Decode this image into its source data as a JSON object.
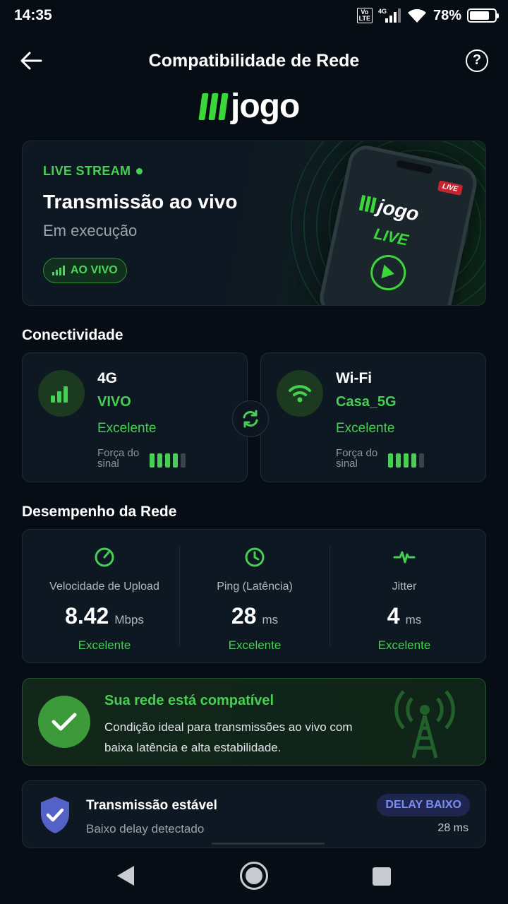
{
  "status_bar": {
    "time": "14:35",
    "volte": "Vo LTE",
    "network": "4G",
    "battery": "78%",
    "battery_level": 0.78
  },
  "header": {
    "title": "Compatibilidade de Rede",
    "help": "?"
  },
  "logo": {
    "text": "jogo"
  },
  "hero": {
    "tag": "LIVE STREAM",
    "title": "Transmissão ao vivo",
    "subtitle": "Em execução",
    "badge": "AO VIVO",
    "phone_badge": "LIVE",
    "phone_logo": "jogo",
    "phone_live": "LIVE"
  },
  "connectivity": {
    "title": "Conectividade",
    "cards": [
      {
        "name": "4G",
        "carrier": "VIVO",
        "quality": "Excelente",
        "signal_label": "Força do sinal",
        "signal_level": 4,
        "signal_max": 5
      },
      {
        "name": "Wi-Fi",
        "carrier": "Casa_5G",
        "quality": "Excelente",
        "signal_label": "Força do sinal",
        "signal_level": 4,
        "signal_max": 5
      }
    ]
  },
  "performance": {
    "title": "Desempenho da Rede",
    "metrics": [
      {
        "label": "Velocidade de Upload",
        "value": "8.42",
        "unit": "Mbps",
        "quality": "Excelente",
        "icon": "speedometer-icon"
      },
      {
        "label": "Ping (Latência)",
        "value": "28",
        "unit": "ms",
        "quality": "Excelente",
        "icon": "clock-icon"
      },
      {
        "label": "Jitter",
        "value": "4",
        "unit": "ms",
        "quality": "Excelente",
        "icon": "pulse-icon"
      }
    ]
  },
  "compat": {
    "title": "Sua rede está compatível",
    "description": "Condição ideal para transmissões ao vivo com baixa latência e alta estabilidade."
  },
  "stable": {
    "title": "Transmissão estável",
    "subtitle": "Baixo delay detectado",
    "badge": "DELAY BAIXO",
    "value": "28 ms"
  },
  "colors": {
    "accent": "#46cf52",
    "background": "#070d15",
    "card": "#0e1822",
    "badge_blue": "#7d8cf0"
  }
}
